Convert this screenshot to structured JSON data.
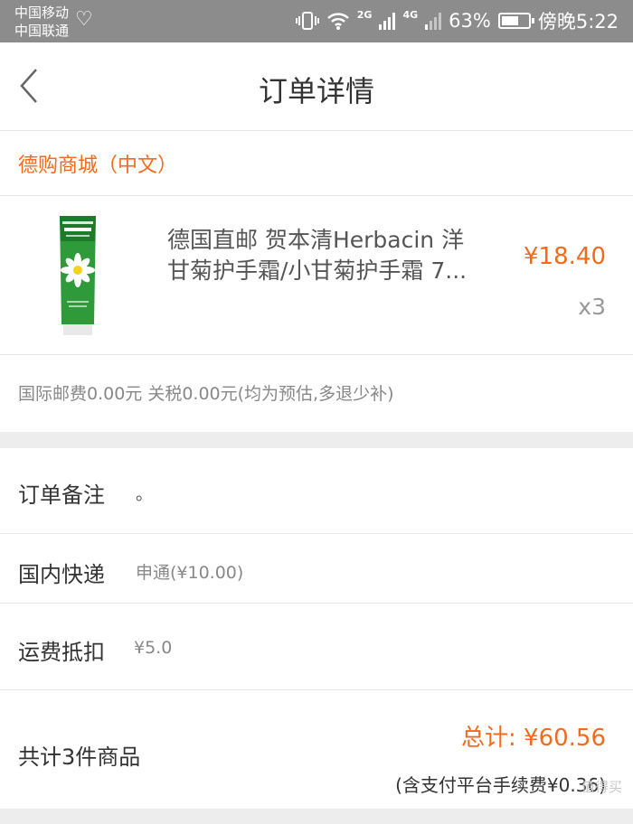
{
  "status_bar": {
    "carrier1": "中国移动",
    "carrier2": "中国联通",
    "network": "2G",
    "network2": "4G",
    "battery": "63%",
    "battery_level": 0.63,
    "time": "傍晚5:22"
  },
  "header": {
    "title": "订单详情"
  },
  "shop": {
    "name": "德购商城（中文）"
  },
  "product": {
    "name_line1": "德国直邮 贺本清Herbacin 洋",
    "name_line2": "甘菊护手霜/小甘菊护手霜 7...",
    "price": "¥18.40",
    "quantity": "x3"
  },
  "fee_note": "国际邮费0.00元 关税0.00元(均为预估,多退少补)",
  "remark": {
    "label": "订单备注",
    "value": "。"
  },
  "delivery": {
    "label": "国内快递",
    "value": "申通(¥10.00)"
  },
  "deduction": {
    "label": "运费抵扣",
    "value": "¥5.0"
  },
  "summary": {
    "count_label": "共计3件商品",
    "total": "总计: ¥60.56",
    "fee_note": "(含支付平台手续费¥0.36)"
  },
  "watermark": "值得买",
  "colors": {
    "accent": "#f26b1d",
    "status_bar": "#8c8c8c"
  }
}
